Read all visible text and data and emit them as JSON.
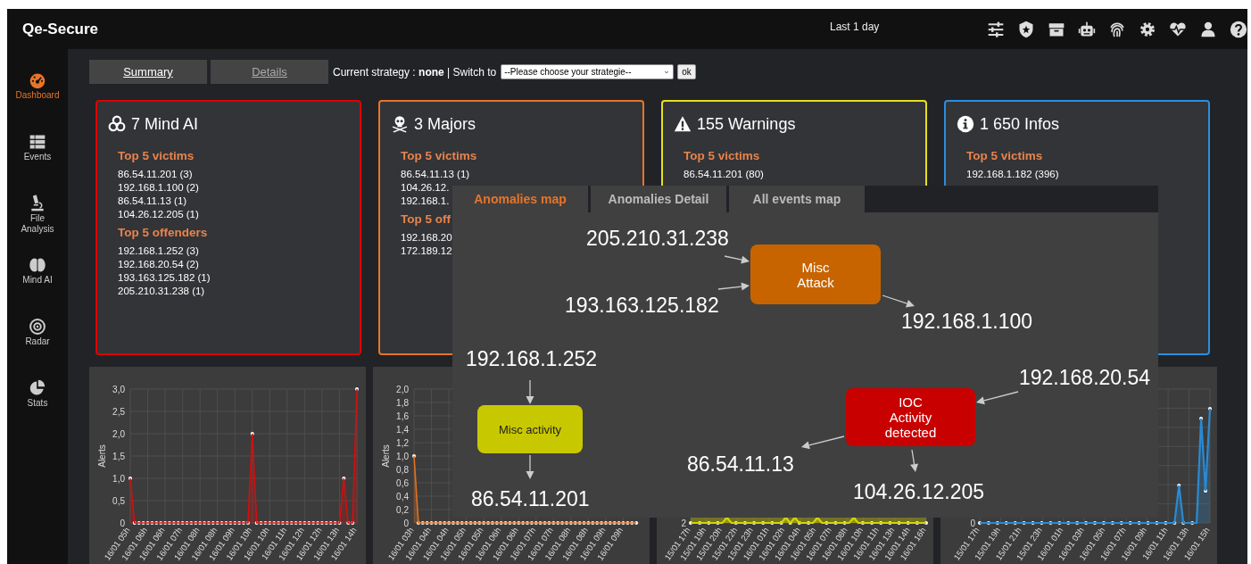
{
  "header": {
    "title": "Qe-Secure",
    "period": "Last 1 day"
  },
  "sidebar": {
    "items": [
      {
        "label": "Dashboard",
        "selected": true
      },
      {
        "label": "Events",
        "selected": false
      },
      {
        "label": "File Analysis",
        "selected": false
      },
      {
        "label": "Mind AI",
        "selected": false
      },
      {
        "label": "Radar",
        "selected": false
      },
      {
        "label": "Stats",
        "selected": false
      }
    ]
  },
  "tabs": [
    {
      "label": "Summary",
      "selected": true
    },
    {
      "label": "Details",
      "selected": false
    }
  ],
  "strategy": {
    "text": "Current strategy : **none** | Switch to",
    "select": "--Please choose your strategie--",
    "button": "ok"
  },
  "cards": [
    {
      "kind": "mind-ai",
      "title": "7 Mind AI",
      "color": "#e00000",
      "sections": [
        {
          "heading": "Top 5 victims",
          "items": [
            "86.54.11.201 (3)",
            "192.168.1.100 (2)",
            "86.54.11.13 (1)",
            "104.26.12.205 (1)"
          ]
        },
        {
          "heading": "Top 5 offenders",
          "items": [
            "192.168.1.252 (3)",
            "192.168.20.54 (2)",
            "193.163.125.182 (1)",
            "205.210.31.238 (1)"
          ]
        }
      ]
    },
    {
      "kind": "major",
      "title": "3 Majors",
      "color": "#e8742a",
      "sections": [
        {
          "heading": "Top 5 victims",
          "items": [
            "86.54.11.13 (1)",
            "104.26.12.",
            "192.168.1."
          ]
        },
        {
          "heading": "Top 5 off",
          "items": [
            "192.168.20",
            "172.189.12"
          ]
        }
      ]
    },
    {
      "kind": "warning",
      "title": "155 Warnings",
      "color": "#e6e020",
      "sections": [
        {
          "heading": "Top 5 victims",
          "items": [
            "86.54.11.201 (80)"
          ]
        }
      ]
    },
    {
      "kind": "info",
      "title": "1 650 Infos",
      "color": "#2a8ee0",
      "sections": [
        {
          "heading": "Top 5 victims",
          "items": [
            "192.168.1.182 (396)"
          ]
        }
      ]
    }
  ],
  "charts": [
    {
      "kind": "chart",
      "chart_data": {
        "type": "area",
        "ylabel": "Alerts",
        "ylim": [
          0,
          3
        ],
        "grid": true,
        "categories": [
          "16/01 05h",
          null,
          null,
          null,
          "16/01 06h",
          null,
          null,
          null,
          "16/01 06h",
          null,
          null,
          null,
          "16/01 07h",
          null,
          null,
          null,
          "16/01 08h",
          null,
          null,
          null,
          "16/01 08h",
          null,
          null,
          null,
          "16/01 09h",
          null,
          null,
          null,
          "16/01 10h",
          null,
          null,
          null,
          "16/01 10h",
          null,
          null,
          null,
          "16/01 11h",
          null,
          null,
          null,
          "16/01 12h",
          null,
          null,
          null,
          "16/01 12h",
          null,
          null,
          null,
          "16/01 13h",
          null,
          null,
          null,
          "16/01 14h"
        ],
        "yticks": [
          0,
          {
            "value": 0.5,
            "label": "0,5"
          },
          {
            "value": 1,
            "label": "1,0"
          },
          {
            "value": 1.5,
            "label": "1,5"
          },
          {
            "value": 2,
            "label": "2,0"
          },
          {
            "value": 2.5,
            "label": "2,5"
          },
          {
            "value": 3,
            "label": "3,0"
          }
        ],
        "series": [
          {
            "color": "#d01010",
            "values": [
              1,
              0,
              0,
              0,
              0,
              0,
              0,
              0,
              0,
              0,
              0,
              0,
              0,
              0,
              0,
              0,
              0,
              0,
              0,
              0,
              0,
              0,
              0,
              0,
              0,
              0,
              0,
              0,
              2,
              0,
              0,
              0,
              0,
              0,
              0,
              0,
              0,
              0,
              0,
              0,
              0,
              0,
              0,
              0,
              0,
              0,
              0,
              0,
              0,
              1,
              0,
              0,
              3
            ]
          }
        ]
      }
    },
    {
      "kind": "chart",
      "chart_data": {
        "type": "area",
        "ylabel": "Alerts",
        "ylim": [
          0,
          2
        ],
        "grid": true,
        "categories": [
          "16/01 03h",
          null,
          null,
          null,
          "16/01 04h",
          null,
          null,
          null,
          "16/01 04h",
          null,
          null,
          null,
          "16/01 05h",
          null,
          null,
          null,
          "16/01 05h",
          null,
          null,
          null,
          "16/01 06h",
          null,
          null,
          null,
          "16/01 06h",
          null,
          null,
          null,
          "16/01 07h",
          null,
          null,
          null,
          "16/01 07h",
          null,
          null,
          null,
          "16/01 08h",
          null,
          null,
          null,
          "16/01 08h",
          null,
          null,
          null,
          "16/01 09h",
          null,
          null,
          null,
          "16/01 09h",
          null,
          null,
          null
        ],
        "yticks": [
          0,
          {
            "value": 0.2,
            "label": "0,2"
          },
          {
            "value": 0.4,
            "label": "0,4"
          },
          {
            "value": 0.6,
            "label": "0,6"
          },
          {
            "value": 0.8,
            "label": "0,8"
          },
          {
            "value": 1,
            "label": "1,0"
          },
          {
            "value": 1.2,
            "label": "1,2"
          },
          {
            "value": 1.4,
            "label": "1,4"
          },
          {
            "value": 1.6,
            "label": "1,6"
          },
          {
            "value": 1.8,
            "label": "1,8"
          },
          {
            "value": 2,
            "label": "2,0"
          }
        ],
        "series": [
          {
            "color": "#e07020",
            "values": [
              1,
              0,
              0,
              0,
              0,
              0,
              0,
              0,
              0,
              0,
              0,
              0,
              0,
              0,
              0,
              0,
              0,
              0,
              0,
              0,
              0,
              0,
              0,
              0,
              0,
              0,
              0,
              0,
              0,
              0,
              0,
              0,
              0,
              0,
              0,
              0,
              0,
              0,
              0,
              0,
              0,
              0,
              0,
              0,
              0,
              0,
              0,
              0,
              0,
              0,
              0,
              0
            ]
          }
        ]
      }
    },
    {
      "kind": "sparkline",
      "color": "#d4d400",
      "y_tick": "2",
      "x_labels": [
        "15/01 17h",
        "15/01 19h",
        "15/01 20h",
        "15/01 22h",
        "15/01 23h",
        "16/01 01h",
        "16/01 02h",
        "16/01 04h",
        "16/01 05h",
        "16/01 07h",
        "16/01 08h",
        "16/01 10h",
        "16/01 11h",
        "16/01 13h",
        "16/01 14h",
        "16/01 16h"
      ]
    },
    {
      "kind": "sparkline",
      "color": "#2a8ad4",
      "y_tick": "0",
      "x_labels": [
        "15/01 17h",
        "15/01 19h",
        "15/01 21h",
        "15/01 23h",
        "16/01 01h",
        "16/01 03h",
        "16/01 05h",
        "16/01 07h",
        "16/01 09h",
        "16/01 11h",
        "16/01 13h",
        "16/01 15h"
      ]
    }
  ],
  "popup": {
    "tabs": [
      {
        "label": "Anomalies map",
        "selected": true
      },
      {
        "label": "Anomalies Detail",
        "selected": false
      },
      {
        "label": "All events map",
        "selected": false
      }
    ],
    "groups": [
      {
        "node": {
          "label": "Misc\nAttack",
          "color": "#c86400"
        },
        "sources": [
          "205.210.31.238",
          "193.163.125.182"
        ],
        "targets": [
          "192.168.1.100"
        ]
      },
      {
        "node": {
          "label": "Misc activity",
          "color": "#c8c800"
        },
        "sources": [
          "192.168.1.252"
        ],
        "targets": [
          "86.54.11.201"
        ]
      },
      {
        "node": {
          "label": "IOC\nActivity\ndetected",
          "color": "#c80000"
        },
        "sources": [
          "192.168.20.54"
        ],
        "targets": [
          "86.54.11.13",
          "104.26.12.205"
        ]
      }
    ]
  }
}
